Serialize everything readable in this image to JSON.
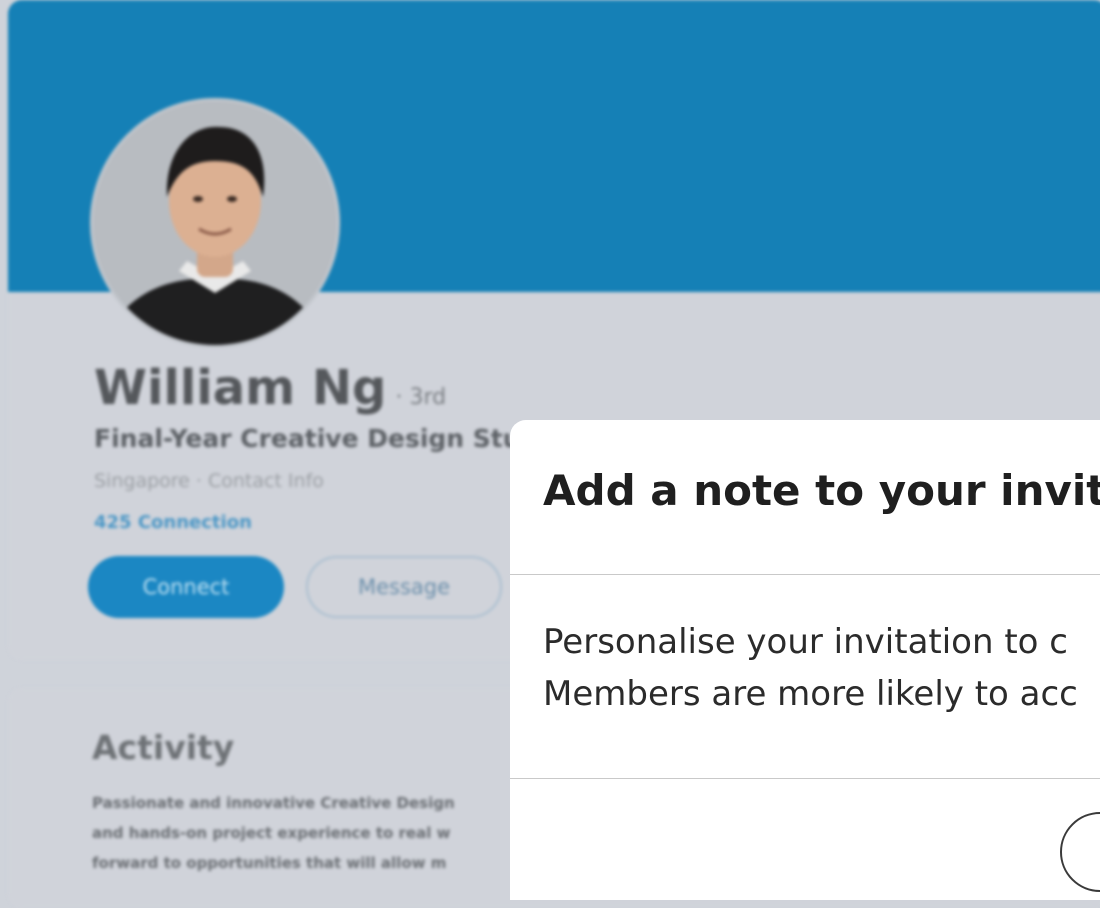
{
  "profile": {
    "name": "William Ng",
    "degree": "· 3rd",
    "headline": "Final-Year Creative Design Stud",
    "location": "Singapore · Contact Info",
    "connections": "425 Connection",
    "connect_label": "Connect",
    "message_label": "Message"
  },
  "activity": {
    "title": "Activity",
    "line1": "Passionate and innovative Creative Design",
    "line2": "and hands-on project experience to real w",
    "line3": "forward to opportunities that will allow m"
  },
  "modal": {
    "title": "Add a note to your invita",
    "body_line1": "Personalise your invitation to c",
    "body_line2": "Members are more likely to acc"
  },
  "colors": {
    "cover": "#1580b6",
    "accent": "#1b87c3"
  }
}
